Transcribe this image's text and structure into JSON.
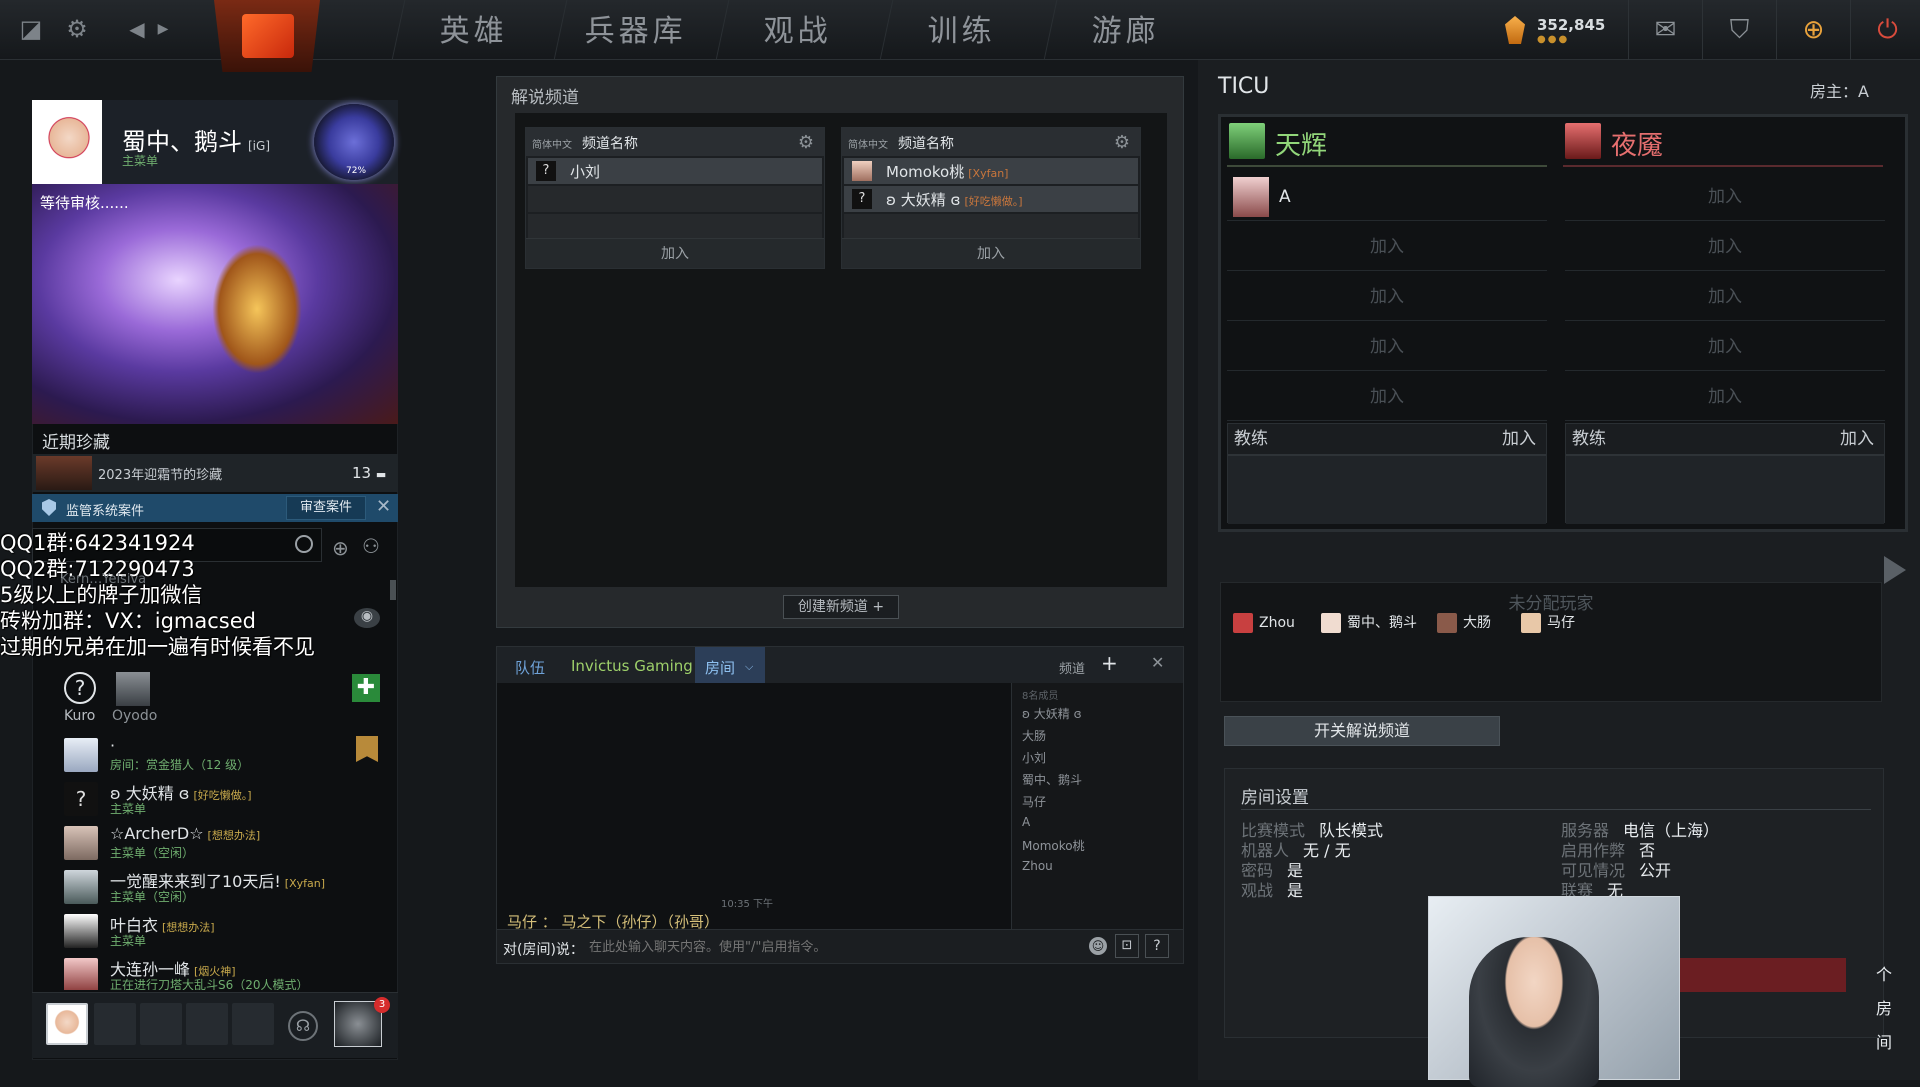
{
  "topbar": {
    "nav": [
      "英雄",
      "兵器库",
      "观战",
      "训练",
      "游廊"
    ],
    "currency": "352,845",
    "currency_dots": "●●●",
    "icons": [
      "dota-icon",
      "gear-icon",
      "back-arrow-icon",
      "forward-arrow-icon",
      "mail-icon",
      "armory-icon",
      "plus-shop-icon",
      "power-icon"
    ]
  },
  "profile": {
    "name": "蜀中、鹅斗",
    "tag": "[iG]",
    "status": "主菜单",
    "rank_pct": "72%",
    "banner_label": "等待审核......"
  },
  "recent": {
    "title": "近期珍藏",
    "item_name": "2023年迎霜节的珍藏",
    "item_count": "13"
  },
  "report": {
    "text": "监管系统案件",
    "button": "审查案件"
  },
  "search": {
    "placeholder": ""
  },
  "overlay": {
    "line1": "QQ1群:642341924",
    "line2": "QQ2群:712290473",
    "line3": "5级以上的牌子加微信",
    "line4": "砖粉加群：VX：igmacsed",
    "line5": "过期的兄弟在加一遍有时候看不见",
    "partial": "Kern…Yelsiva"
  },
  "quick_friends": [
    {
      "name": "Kuro"
    },
    {
      "name": "Oyodo"
    }
  ],
  "friends": [
    {
      "name": "·",
      "tag": "",
      "status": "房间：赏金猎人（12 级）"
    },
    {
      "name": "ʚ 大妖精 ɞ",
      "tag": "[好吃懒做。]",
      "status": "主菜单"
    },
    {
      "name": "☆ArcherD☆",
      "tag": "[想想办法]",
      "status": "主菜单（空闲）"
    },
    {
      "name": "一觉醒来来到了10天后!",
      "tag": "[Xyfan]",
      "status": "主菜单（空闲）"
    },
    {
      "name": "叶白衣",
      "tag": "[想想办法]",
      "status": "主菜单"
    },
    {
      "name": "大连孙一峰",
      "tag": "[烟火神]",
      "status": "正在进行刀塔大乱斗S6（20人模式）"
    }
  ],
  "party": {
    "badge": "3"
  },
  "broadcast": {
    "title": "解说频道",
    "create_button": "创建新频道",
    "channels": [
      {
        "lang": "简体中文",
        "name": "频道名称",
        "members": [
          {
            "name": "小刘",
            "tag": ""
          }
        ],
        "join": "加入"
      },
      {
        "lang": "简体中文",
        "name": "频道名称",
        "members": [
          {
            "name": "Momoko桃",
            "tag": "[Xyfan]"
          },
          {
            "name": "ʚ 大妖精 ɞ",
            "tag": "[好吃懒做。]"
          }
        ],
        "join": "加入"
      }
    ]
  },
  "chat": {
    "tab_team": "队伍",
    "tab_guild": "Invictus Gaming",
    "tab_room": "房间",
    "channel_label": "频道",
    "member_count": "8名成员",
    "members": [
      "ʚ 大妖精 ɞ",
      "大肠",
      "小刘",
      "蜀中、鹅斗",
      "马仔",
      "A",
      "Momoko桃",
      "Zhou"
    ],
    "time": "10:35 下午",
    "message": "马仔 ： 马之下（孙仔）（孙哥）",
    "prefix": "对(房间)说：",
    "input_placeholder": "在此处输入聊天内容。使用\"/\"启用指令。"
  },
  "lobby": {
    "name": "TICU",
    "host": "房主：A",
    "radiant": {
      "name": "天辉",
      "slots": [
        "A",
        "加入",
        "加入",
        "加入",
        "加入"
      ]
    },
    "dire": {
      "name": "夜魇",
      "slots": [
        "加入",
        "加入",
        "加入",
        "加入",
        "加入"
      ]
    },
    "coach_label": "教练",
    "coach_join": "加入",
    "unassigned_title": "未分配玩家",
    "unassigned": [
      "Zhou",
      "蜀中、鹅斗",
      "大肠",
      "马仔"
    ],
    "toggle_broadcast": "开关解说频道",
    "settings_title": "房间设置",
    "settings_left": [
      {
        "k": "比赛模式",
        "v": "队长模式"
      },
      {
        "k": "机器人",
        "v": "无 / 无"
      },
      {
        "k": "密码",
        "v": "是"
      },
      {
        "k": "观战",
        "v": "是"
      }
    ],
    "settings_right": [
      {
        "k": "服务器",
        "v": "电信（上海）"
      },
      {
        "k": "启用作弊",
        "v": "否"
      },
      {
        "k": "可见情况",
        "v": "公开"
      },
      {
        "k": "联赛",
        "v": "无"
      }
    ],
    "leave": "个房间"
  },
  "colors": {
    "radiant": "#92d67a",
    "dire": "#e66f6f",
    "accent": "#2c5a7a"
  }
}
